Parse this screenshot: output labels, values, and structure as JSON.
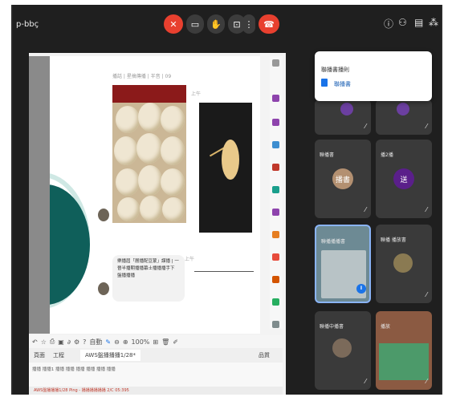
{
  "meeting": {
    "title": "p-bbç"
  },
  "popup": {
    "title": "聯播書播則",
    "link": "聯播書"
  },
  "document": {
    "meta": "播話 | 星搞傳播 | 半音 | 09",
    "bubble": "樂播屆「層播配豆蒙」謀播 | 一晉半播期播播幕士播播播手下 盤播播播",
    "mark_top": "上午",
    "mark_mid": "上午"
  },
  "toolbar": {
    "page_label": "自動",
    "zoom": "100%"
  },
  "tabs": {
    "tab1": "頁面",
    "tab2": "工程",
    "tab3": "AWS盤播播播1/28*",
    "right": "品質"
  },
  "menubar": {
    "text": "播播 播播1 播播 播播 播播 播播 播播 播播"
  },
  "taskbar": {
    "text": "AWS盤播播播1/28 Ping - 播播播播播播 2/C 05:395"
  },
  "tiles": [
    {
      "name": "聯播書",
      "avatar": "播書",
      "avatar_color": "#b39071"
    },
    {
      "name": "播2播",
      "avatar": "送",
      "avatar_color": "#5a1f8a"
    },
    {
      "name": "聯播播播書",
      "avatar": "",
      "avatar_color": ""
    },
    {
      "name": "聯播 播放書",
      "avatar": "",
      "avatar_color": ""
    },
    {
      "name": "聯播中播書",
      "avatar": "",
      "avatar_color": ""
    },
    {
      "name": "播放",
      "avatar": "",
      "avatar_color": ""
    }
  ],
  "colors": {
    "end_call": "#e8402f",
    "accent": "#1a73e8",
    "teal": "#0f5f5a"
  }
}
